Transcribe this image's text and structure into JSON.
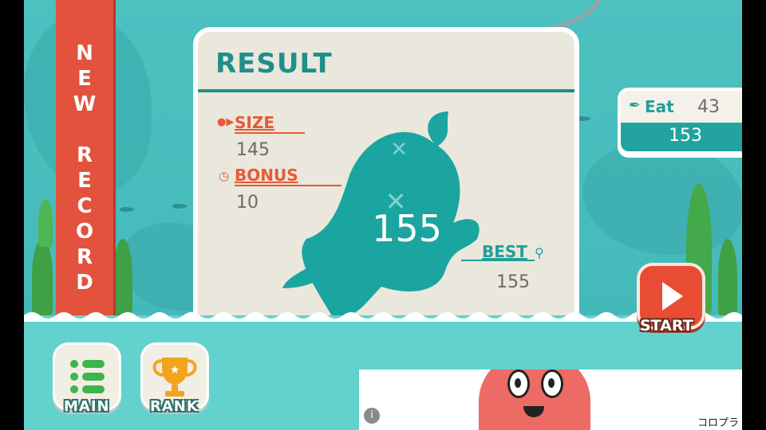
{
  "banner": {
    "text": "NEW RECORD"
  },
  "result": {
    "title": "RESULT",
    "size_label": "SIZE",
    "size_value": "145",
    "bonus_label": "BONUS",
    "bonus_value": "10",
    "score": "155",
    "best_label": "BEST",
    "best_value": "155"
  },
  "eat_panel": {
    "label": "Eat",
    "count": "43",
    "total": "153"
  },
  "buttons": {
    "main": "MAIN",
    "rank": "RANK",
    "start": "START"
  },
  "ad": {
    "brand": "コロプラ",
    "info_icon": "i"
  },
  "colors": {
    "water": "#4cc1c0",
    "accent_teal": "#1f8f8a",
    "accent_red": "#e65a38",
    "banner_red": "#e2523d"
  },
  "icons": [
    "fish-icon",
    "clock-icon",
    "trophy-icon",
    "fork-icon",
    "list-icon",
    "play-icon",
    "info-icon"
  ]
}
